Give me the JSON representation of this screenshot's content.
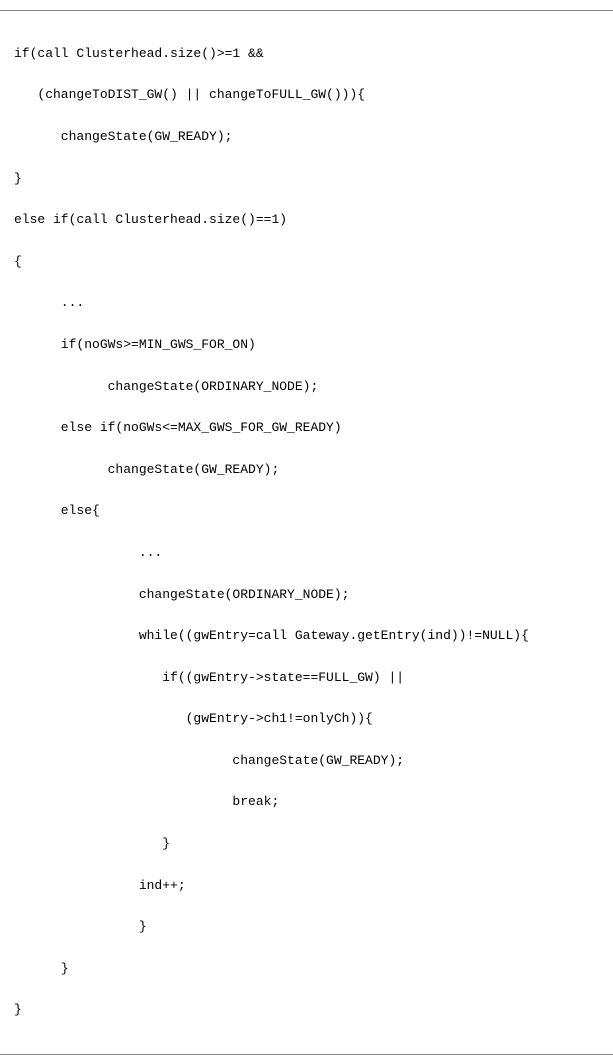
{
  "lines": [
    "if(call Clusterhead.size()>=1 &&",
    "   (changeToDIST_GW() || changeToFULL_GW())){",
    "      changeState(GW_READY);",
    "}",
    "else if(call Clusterhead.size()==1)",
    "{",
    "      ...",
    "      if(noGWs>=MIN_GWS_FOR_ON)",
    "            changeState(ORDINARY_NODE);",
    "      else if(noGWs<=MAX_GWS_FOR_GW_READY)",
    "            changeState(GW_READY);",
    "      else{",
    "                ...",
    "                changeState(ORDINARY_NODE);",
    "                while((gwEntry=call Gateway.getEntry(ind))!=NULL){",
    "                   if((gwEntry->state==FULL_GW) ||",
    "                      (gwEntry->ch1!=onlyCh)){",
    "                            changeState(GW_READY);",
    "                            break;",
    "                   }",
    "                ind++;",
    "                }",
    "      }",
    "}"
  ]
}
